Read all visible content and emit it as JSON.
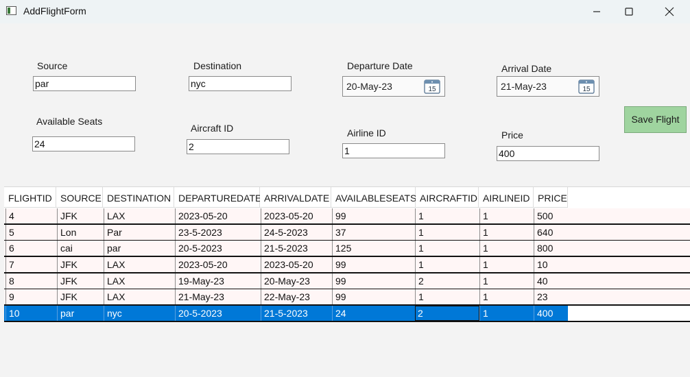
{
  "window": {
    "title": "AddFlightForm"
  },
  "form": {
    "source": {
      "label": "Source",
      "value": "par"
    },
    "destination": {
      "label": "Destination",
      "value": "nyc"
    },
    "departure_date": {
      "label": "Departure Date",
      "value": "20-May-23"
    },
    "arrival_date": {
      "label": "Arrival Date",
      "value": "21-May-23"
    },
    "available_seats": {
      "label": "Available Seats",
      "value": "24"
    },
    "aircraft_id": {
      "label": "Aircraft ID",
      "value": "2"
    },
    "airline_id": {
      "label": "Airline ID",
      "value": "1"
    },
    "price": {
      "label": "Price",
      "value": "400"
    },
    "calendar_day": "15",
    "save_label": "Save Flight"
  },
  "grid": {
    "columns": [
      "FLIGHTID",
      "SOURCE",
      "DESTINATION",
      "DEPARTUREDATE",
      "ARRIVALDATE",
      "AVAILABLESEATS",
      "AIRCRAFTID",
      "AIRLINEID",
      "PRICE"
    ],
    "rows": [
      [
        "4",
        "JFK",
        "LAX",
        "2023-05-20",
        "2023-05-20",
        "99",
        "1",
        "1",
        "500"
      ],
      [
        "5",
        "Lon",
        "Par",
        "23-5-2023",
        "24-5-2023",
        "37",
        "1",
        "1",
        "640"
      ],
      [
        "6",
        "cai",
        "par",
        "20-5-2023",
        "21-5-2023",
        "125",
        "1",
        "1",
        "800"
      ],
      [
        "7",
        "JFK",
        "LAX",
        "2023-05-20",
        "2023-05-20",
        "99",
        "1",
        "1",
        "10"
      ],
      [
        "8",
        "JFK",
        "LAX",
        "19-May-23",
        "20-May-23",
        "99",
        "2",
        "1",
        "40"
      ],
      [
        "9",
        "JFK",
        "LAX",
        "21-May-23",
        "22-May-23",
        "99",
        "1",
        "1",
        "23"
      ],
      [
        "10",
        "par",
        "nyc",
        "20-5-2023",
        "21-5-2023",
        "24",
        "2",
        "1",
        "400"
      ]
    ],
    "selected_row_index": 6,
    "focused_column_index": 6
  },
  "colors": {
    "selection": "#0078d7",
    "save_button": "#9fd49f",
    "row_background": "#fff6f6"
  },
  "icons": {
    "app": "window-app-icon",
    "minimize": "minimize-icon",
    "maximize": "maximize-icon",
    "close": "close-icon",
    "calendar": "calendar-icon"
  }
}
